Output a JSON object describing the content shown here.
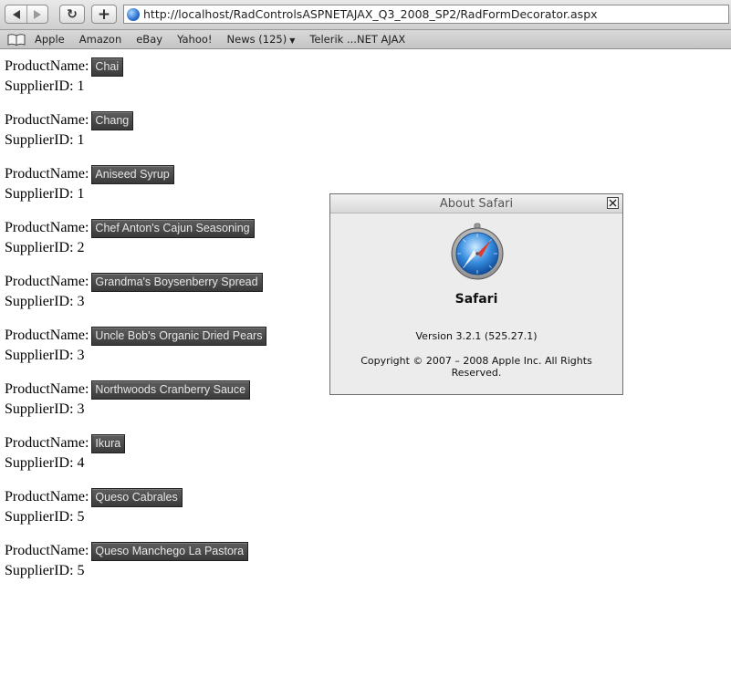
{
  "toolbar": {
    "url": "http://localhost/RadControlsASPNETAJAX_Q3_2008_SP2/RadFormDecorator.aspx",
    "reload_glyph": "↻",
    "add_glyph": "+"
  },
  "bookmarks": {
    "items": [
      {
        "label": "Apple"
      },
      {
        "label": "Amazon"
      },
      {
        "label": "eBay"
      },
      {
        "label": "Yahoo!"
      },
      {
        "label": "News (125)",
        "has_menu": true
      },
      {
        "label": "Telerik ...NET AJAX"
      }
    ]
  },
  "labels": {
    "product": "ProductName:",
    "supplier": "SupplierID:"
  },
  "products": [
    {
      "name": "Chai",
      "supplier_id": "1"
    },
    {
      "name": "Chang",
      "supplier_id": "1"
    },
    {
      "name": "Aniseed Syrup",
      "supplier_id": "1"
    },
    {
      "name": "Chef Anton's Cajun Seasoning",
      "supplier_id": "2"
    },
    {
      "name": "Grandma's Boysenberry Spread",
      "supplier_id": "3"
    },
    {
      "name": "Uncle Bob's Organic Dried Pears",
      "supplier_id": "3"
    },
    {
      "name": "Northwoods Cranberry Sauce",
      "supplier_id": "3"
    },
    {
      "name": "Ikura",
      "supplier_id": "4"
    },
    {
      "name": "Queso Cabrales",
      "supplier_id": "5"
    },
    {
      "name": "Queso Manchego La Pastora",
      "supplier_id": "5"
    }
  ],
  "dialog": {
    "title": "About Safari",
    "app_name": "Safari",
    "version": "Version 3.2.1 (525.27.1)",
    "copyright": "Copyright © 2007 – 2008 Apple Inc. All Rights Reserved."
  },
  "colors": {
    "button_bg": "#4a4a4a",
    "button_text": "#e6e6e6",
    "dialog_bg": "#ececec"
  }
}
